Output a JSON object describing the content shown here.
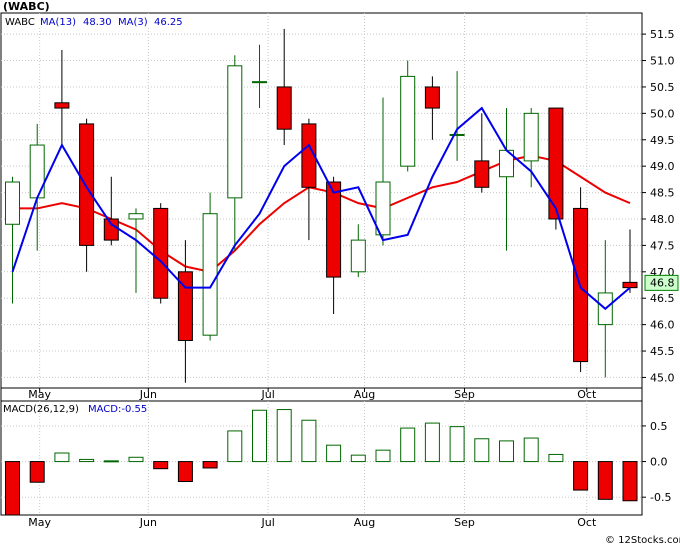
{
  "chart_data": {
    "type": "candlestick",
    "ticker": "(WABC)",
    "price_chart": {
      "legend": [
        {
          "label": "WABC",
          "color": "#000000"
        },
        {
          "label": "MA(13)",
          "value": "48.30",
          "color": "#0000cc"
        },
        {
          "label": "MA(3)",
          "value": "46.25",
          "color": "#0000cc"
        }
      ],
      "ylim": [
        44.8,
        51.9
      ],
      "y_ticks": [
        "45.0",
        "45.5",
        "46.0",
        "46.5",
        "47.0",
        "47.5",
        "48.0",
        "48.5",
        "49.0",
        "49.5",
        "50.0",
        "50.5",
        "51.0",
        "51.5"
      ],
      "last_price_label": "46.8",
      "candles": [
        {
          "o": 47.9,
          "h": 48.8,
          "l": 46.4,
          "c": 48.7
        },
        {
          "o": 48.4,
          "h": 49.8,
          "l": 47.4,
          "c": 49.4
        },
        {
          "o": 50.2,
          "h": 51.2,
          "l": 49.4,
          "c": 50.1
        },
        {
          "o": 49.8,
          "h": 49.9,
          "l": 47.0,
          "c": 47.5
        },
        {
          "o": 48.0,
          "h": 48.8,
          "l": 47.5,
          "c": 47.6
        },
        {
          "o": 48.0,
          "h": 48.2,
          "l": 46.6,
          "c": 48.1
        },
        {
          "o": 48.2,
          "h": 48.3,
          "l": 46.4,
          "c": 46.5
        },
        {
          "o": 47.0,
          "h": 47.6,
          "l": 44.9,
          "c": 45.7
        },
        {
          "o": 45.8,
          "h": 48.5,
          "l": 45.7,
          "c": 48.1
        },
        {
          "o": 48.4,
          "h": 51.1,
          "l": 47.4,
          "c": 50.9
        },
        {
          "o": 50.6,
          "h": 51.3,
          "l": 50.1,
          "c": 50.6
        },
        {
          "o": 50.5,
          "h": 51.6,
          "l": 49.4,
          "c": 49.7
        },
        {
          "o": 49.8,
          "h": 49.9,
          "l": 47.6,
          "c": 48.6
        },
        {
          "o": 48.7,
          "h": 48.8,
          "l": 46.2,
          "c": 46.9
        },
        {
          "o": 47.0,
          "h": 47.9,
          "l": 46.9,
          "c": 47.6
        },
        {
          "o": 47.7,
          "h": 50.3,
          "l": 47.5,
          "c": 48.7
        },
        {
          "o": 49.0,
          "h": 51.0,
          "l": 48.9,
          "c": 50.7
        },
        {
          "o": 50.5,
          "h": 50.7,
          "l": 49.5,
          "c": 50.1
        },
        {
          "o": 49.6,
          "h": 50.8,
          "l": 49.1,
          "c": 49.6
        },
        {
          "o": 49.1,
          "h": 50.0,
          "l": 48.5,
          "c": 48.6
        },
        {
          "o": 48.8,
          "h": 50.1,
          "l": 47.4,
          "c": 49.3
        },
        {
          "o": 49.1,
          "h": 50.1,
          "l": 48.6,
          "c": 50.0
        },
        {
          "o": 50.1,
          "h": 50.1,
          "l": 47.8,
          "c": 48.0
        },
        {
          "o": 48.2,
          "h": 48.6,
          "l": 45.1,
          "c": 45.3
        },
        {
          "o": 46.0,
          "h": 47.6,
          "l": 45.0,
          "c": 46.6
        },
        {
          "o": 46.8,
          "h": 47.8,
          "l": 46.6,
          "c": 46.7
        }
      ],
      "ma_blue": [
        47.0,
        48.4,
        49.4,
        48.6,
        47.9,
        47.6,
        47.2,
        46.7,
        46.7,
        47.5,
        48.1,
        49.0,
        49.4,
        48.5,
        48.6,
        47.6,
        47.7,
        48.8,
        49.7,
        50.1,
        49.3,
        48.9,
        48.2,
        46.7,
        46.3,
        46.7
      ],
      "ma_red": [
        48.2,
        48.2,
        48.3,
        48.2,
        48.0,
        47.8,
        47.4,
        47.1,
        47.0,
        47.4,
        47.9,
        48.3,
        48.6,
        48.5,
        48.3,
        48.2,
        48.4,
        48.6,
        48.7,
        48.9,
        49.1,
        49.2,
        49.1,
        48.8,
        48.5,
        48.3
      ]
    },
    "macd_chart": {
      "label": "MACD(26,12,9)",
      "value_label": "MACD:-0.55",
      "ylim": [
        -0.75,
        0.85
      ],
      "y_ticks": [
        "0.5",
        "0.0",
        "-0.5"
      ],
      "values": [
        -0.75,
        -0.29,
        0.12,
        0.03,
        0.01,
        0.06,
        -0.1,
        -0.28,
        -0.09,
        0.43,
        0.72,
        0.73,
        0.58,
        0.23,
        0.09,
        0.16,
        0.47,
        0.54,
        0.49,
        0.32,
        0.29,
        0.33,
        0.1,
        -0.4,
        -0.53,
        -0.55
      ]
    },
    "x_labels": [
      {
        "label": "May",
        "index": 1.1
      },
      {
        "label": "Jun",
        "index": 5.5
      },
      {
        "label": "Jul",
        "index": 10.35
      },
      {
        "label": "Aug",
        "index": 14.25
      },
      {
        "label": "Sep",
        "index": 18.3
      },
      {
        "label": "Oct",
        "index": 23.25
      }
    ],
    "grid": true
  },
  "watermark": "© 12Stocks.com"
}
